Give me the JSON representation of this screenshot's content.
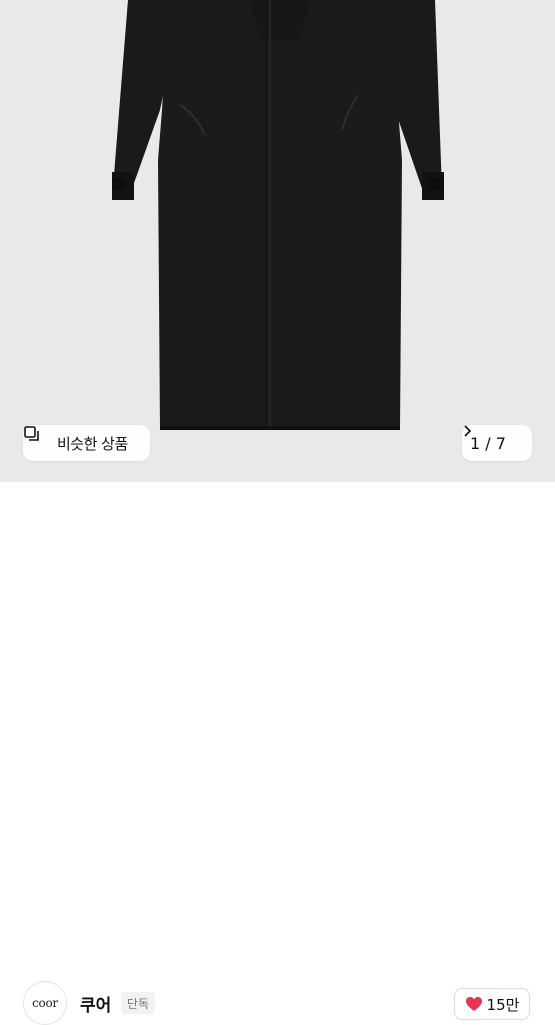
{
  "product": {
    "similar_button_label": "비슷한 상품",
    "page_indicator": "1 / 7",
    "coat_color": "#1b1b1b"
  },
  "seller": {
    "logo_text": "coor",
    "name": "쿠어",
    "badge": "단독"
  },
  "like": {
    "count": "15만",
    "heart_color": "#e8344e"
  }
}
